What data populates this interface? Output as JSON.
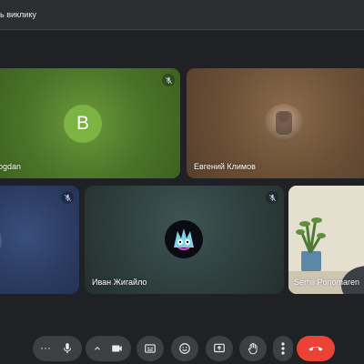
{
  "topbar": {
    "text": "ь виклику"
  },
  "participants": [
    {
      "name": "ogdan",
      "initial": "B",
      "muted": true
    },
    {
      "name": "Евгений Климов",
      "muted": false
    },
    {
      "name": "",
      "muted": true
    },
    {
      "name": "Иван Жигайло",
      "muted": true
    },
    {
      "name": "Serhii Ponomaren",
      "muted": false
    }
  ],
  "controls": {
    "more_dots": "···",
    "end_call_color": "#ea4335",
    "icons": [
      "more-icon",
      "microphone-icon",
      "chevron-up-icon",
      "camera-icon",
      "captions-icon",
      "emoji-icon",
      "present-icon",
      "raise-hand-icon",
      "more-vert-icon",
      "end-call-icon"
    ]
  },
  "colors": {
    "background": "#202124",
    "control": "#3c4043",
    "avatar_green": "#7cb342"
  }
}
